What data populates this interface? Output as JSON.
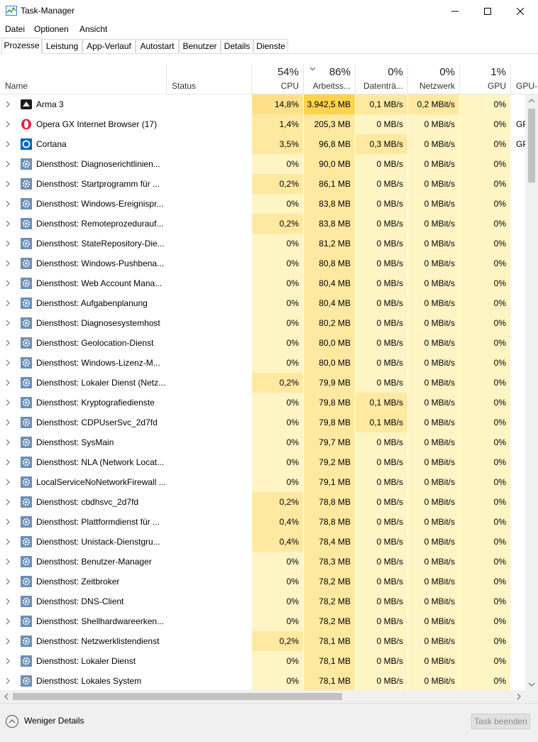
{
  "window": {
    "title": "Task-Manager"
  },
  "menu": [
    "Datei",
    "Optionen",
    "Ansicht"
  ],
  "tabs": [
    {
      "label": "Prozesse",
      "active": true
    },
    {
      "label": "Leistung"
    },
    {
      "label": "App-Verlauf"
    },
    {
      "label": "Autostart"
    },
    {
      "label": "Benutzer"
    },
    {
      "label": "Details"
    },
    {
      "label": "Dienste"
    }
  ],
  "columns": {
    "name": "Name",
    "status": "Status",
    "cpu": {
      "pct": "54%",
      "label": "CPU"
    },
    "mem": {
      "pct": "86%",
      "label": "Arbeitss..."
    },
    "disk": {
      "pct": "0%",
      "label": "Datenträ..."
    },
    "net": {
      "pct": "0%",
      "label": "Netzwerk"
    },
    "gpu": {
      "pct": "1%",
      "label": "GPU"
    },
    "gpu_engine": {
      "label": "GPU-..."
    }
  },
  "colors": {
    "light": "#fff4c4",
    "mid": "#ffe9a1",
    "strong": "#ffd34d",
    "cpu_strong": "#ffe08a"
  },
  "rows": [
    {
      "icon": "arma-icon",
      "name": "Arma 3",
      "cpu": "14,8%",
      "mem": "3.942,5 MB",
      "disk": "0,1 MB/s",
      "net": "0,2 MBit/s",
      "gpu": "0%",
      "gpu2": "",
      "h": {
        "cpu": "cpu_strong",
        "mem": "strong",
        "disk": "mid",
        "net": "mid"
      }
    },
    {
      "icon": "opera-icon",
      "name": "Opera GX Internet Browser (17)",
      "cpu": "1,4%",
      "mem": "205,3 MB",
      "disk": "0 MB/s",
      "net": "0 MBit/s",
      "gpu": "0%",
      "gpu2": "GPU",
      "h": {
        "cpu": "mid",
        "mem": "mid"
      }
    },
    {
      "icon": "cortana-icon",
      "name": "Cortana",
      "cpu": "3,5%",
      "mem": "96,8 MB",
      "disk": "0,3 MB/s",
      "net": "0 MBit/s",
      "gpu": "0%",
      "gpu2": "GPU",
      "h": {
        "cpu": "mid",
        "mem": "mid",
        "disk": "mid"
      }
    },
    {
      "icon": "gear-icon",
      "name": "Diensthost: Diagnoserichtlinien...",
      "cpu": "0%",
      "mem": "90,0 MB",
      "disk": "0 MB/s",
      "net": "0 MBit/s",
      "gpu": "0%",
      "gpu2": "",
      "h": {
        "mem": "mid"
      }
    },
    {
      "icon": "gear-icon",
      "name": "Diensthost: Startprogramm für ...",
      "cpu": "0,2%",
      "mem": "86,1 MB",
      "disk": "0 MB/s",
      "net": "0 MBit/s",
      "gpu": "0%",
      "gpu2": "",
      "h": {
        "cpu": "mid",
        "mem": "mid"
      }
    },
    {
      "icon": "gear-icon",
      "name": "Diensthost: Windows-Ereignispr...",
      "cpu": "0%",
      "mem": "83,8 MB",
      "disk": "0 MB/s",
      "net": "0 MBit/s",
      "gpu": "0%",
      "gpu2": "",
      "h": {
        "mem": "mid"
      }
    },
    {
      "icon": "gear-icon",
      "name": "Diensthost: Remoteprozedurauf...",
      "cpu": "0,2%",
      "mem": "83,8 MB",
      "disk": "0 MB/s",
      "net": "0 MBit/s",
      "gpu": "0%",
      "gpu2": "",
      "h": {
        "cpu": "mid",
        "mem": "mid"
      }
    },
    {
      "icon": "gear-icon",
      "name": "Diensthost: StateRepository-Die...",
      "cpu": "0%",
      "mem": "81,2 MB",
      "disk": "0 MB/s",
      "net": "0 MBit/s",
      "gpu": "0%",
      "gpu2": "",
      "h": {
        "mem": "mid"
      }
    },
    {
      "icon": "gear-icon",
      "name": "Diensthost: Windows-Pushbena...",
      "cpu": "0%",
      "mem": "80,8 MB",
      "disk": "0 MB/s",
      "net": "0 MBit/s",
      "gpu": "0%",
      "gpu2": "",
      "h": {
        "mem": "mid"
      }
    },
    {
      "icon": "gear-icon",
      "name": "Diensthost: Web Account Mana...",
      "cpu": "0%",
      "mem": "80,4 MB",
      "disk": "0 MB/s",
      "net": "0 MBit/s",
      "gpu": "0%",
      "gpu2": "",
      "h": {
        "mem": "mid"
      }
    },
    {
      "icon": "gear-icon",
      "name": "Diensthost: Aufgabenplanung",
      "cpu": "0%",
      "mem": "80,4 MB",
      "disk": "0 MB/s",
      "net": "0 MBit/s",
      "gpu": "0%",
      "gpu2": "",
      "h": {
        "mem": "mid"
      }
    },
    {
      "icon": "gear-icon",
      "name": "Diensthost: Diagnosesystemhost",
      "cpu": "0%",
      "mem": "80,2 MB",
      "disk": "0 MB/s",
      "net": "0 MBit/s",
      "gpu": "0%",
      "gpu2": "",
      "h": {
        "mem": "mid"
      }
    },
    {
      "icon": "gear-icon",
      "name": "Diensthost: Geolocation-Dienst",
      "cpu": "0%",
      "mem": "80,0 MB",
      "disk": "0 MB/s",
      "net": "0 MBit/s",
      "gpu": "0%",
      "gpu2": "",
      "h": {
        "mem": "mid"
      }
    },
    {
      "icon": "gear-icon",
      "name": "Diensthost: Windows-Lizenz-M...",
      "cpu": "0%",
      "mem": "80,0 MB",
      "disk": "0 MB/s",
      "net": "0 MBit/s",
      "gpu": "0%",
      "gpu2": "",
      "h": {
        "mem": "mid"
      }
    },
    {
      "icon": "gear-icon",
      "name": "Diensthost: Lokaler Dienst (Netz...",
      "cpu": "0,2%",
      "mem": "79,9 MB",
      "disk": "0 MB/s",
      "net": "0 MBit/s",
      "gpu": "0%",
      "gpu2": "",
      "h": {
        "cpu": "mid",
        "mem": "mid"
      }
    },
    {
      "icon": "gear-icon",
      "name": "Diensthost: Kryptografiedienste",
      "cpu": "0%",
      "mem": "79,8 MB",
      "disk": "0,1 MB/s",
      "net": "0 MBit/s",
      "gpu": "0%",
      "gpu2": "",
      "h": {
        "mem": "mid",
        "disk": "mid"
      }
    },
    {
      "icon": "gear-icon",
      "name": "Diensthost: CDPUserSvc_2d7fd",
      "cpu": "0%",
      "mem": "79,8 MB",
      "disk": "0,1 MB/s",
      "net": "0 MBit/s",
      "gpu": "0%",
      "gpu2": "",
      "h": {
        "mem": "mid",
        "disk": "mid"
      }
    },
    {
      "icon": "gear-icon",
      "name": "Diensthost: SysMain",
      "cpu": "0%",
      "mem": "79,7 MB",
      "disk": "0 MB/s",
      "net": "0 MBit/s",
      "gpu": "0%",
      "gpu2": "",
      "h": {
        "mem": "mid"
      }
    },
    {
      "icon": "gear-icon",
      "name": "Diensthost: NLA (Network Locat...",
      "cpu": "0%",
      "mem": "79,2 MB",
      "disk": "0 MB/s",
      "net": "0 MBit/s",
      "gpu": "0%",
      "gpu2": "",
      "h": {
        "mem": "mid"
      }
    },
    {
      "icon": "gear-icon",
      "name": "LocalServiceNoNetworkFirewall ...",
      "cpu": "0%",
      "mem": "79,1 MB",
      "disk": "0 MB/s",
      "net": "0 MBit/s",
      "gpu": "0%",
      "gpu2": "",
      "h": {
        "mem": "mid"
      }
    },
    {
      "icon": "gear-icon",
      "name": "Diensthost: cbdhsvc_2d7fd",
      "cpu": "0,2%",
      "mem": "78,8 MB",
      "disk": "0 MB/s",
      "net": "0 MBit/s",
      "gpu": "0%",
      "gpu2": "",
      "h": {
        "cpu": "mid",
        "mem": "mid"
      }
    },
    {
      "icon": "gear-icon",
      "name": "Diensthost: Plattformdienst für ...",
      "cpu": "0,4%",
      "mem": "78,8 MB",
      "disk": "0 MB/s",
      "net": "0 MBit/s",
      "gpu": "0%",
      "gpu2": "",
      "h": {
        "cpu": "mid",
        "mem": "mid"
      }
    },
    {
      "icon": "gear-icon",
      "name": "Diensthost: Unistack-Dienstgru...",
      "cpu": "0,4%",
      "mem": "78,4 MB",
      "disk": "0 MB/s",
      "net": "0 MBit/s",
      "gpu": "0%",
      "gpu2": "",
      "h": {
        "cpu": "mid",
        "mem": "mid"
      }
    },
    {
      "icon": "gear-icon",
      "name": "Diensthost: Benutzer-Manager",
      "cpu": "0%",
      "mem": "78,3 MB",
      "disk": "0 MB/s",
      "net": "0 MBit/s",
      "gpu": "0%",
      "gpu2": "",
      "h": {
        "mem": "mid"
      }
    },
    {
      "icon": "gear-icon",
      "name": "Diensthost: Zeitbroker",
      "cpu": "0%",
      "mem": "78,2 MB",
      "disk": "0 MB/s",
      "net": "0 MBit/s",
      "gpu": "0%",
      "gpu2": "",
      "h": {
        "mem": "mid"
      }
    },
    {
      "icon": "gear-icon",
      "name": "Diensthost: DNS-Client",
      "cpu": "0%",
      "mem": "78,2 MB",
      "disk": "0 MB/s",
      "net": "0 MBit/s",
      "gpu": "0%",
      "gpu2": "",
      "h": {
        "mem": "mid"
      }
    },
    {
      "icon": "gear-icon",
      "name": "Diensthost: Shellhardwareerken...",
      "cpu": "0%",
      "mem": "78,2 MB",
      "disk": "0 MB/s",
      "net": "0 MBit/s",
      "gpu": "0%",
      "gpu2": "",
      "h": {
        "mem": "mid"
      }
    },
    {
      "icon": "gear-icon",
      "name": "Diensthost: Netzwerklistendienst",
      "cpu": "0,2%",
      "mem": "78,1 MB",
      "disk": "0 MB/s",
      "net": "0 MBit/s",
      "gpu": "0%",
      "gpu2": "",
      "h": {
        "cpu": "mid",
        "mem": "mid"
      }
    },
    {
      "icon": "gear-icon",
      "name": "Diensthost: Lokaler Dienst",
      "cpu": "0%",
      "mem": "78,1 MB",
      "disk": "0 MB/s",
      "net": "0 MBit/s",
      "gpu": "0%",
      "gpu2": "",
      "h": {
        "mem": "mid"
      }
    },
    {
      "icon": "gear-icon",
      "name": "Diensthost: Lokales System",
      "cpu": "0%",
      "mem": "78,1 MB",
      "disk": "0 MB/s",
      "net": "0 MBit/s",
      "gpu": "0%",
      "gpu2": "",
      "h": {
        "mem": "mid"
      }
    }
  ],
  "footer": {
    "less_details": "Weniger Details",
    "end_task": "Task beenden"
  }
}
